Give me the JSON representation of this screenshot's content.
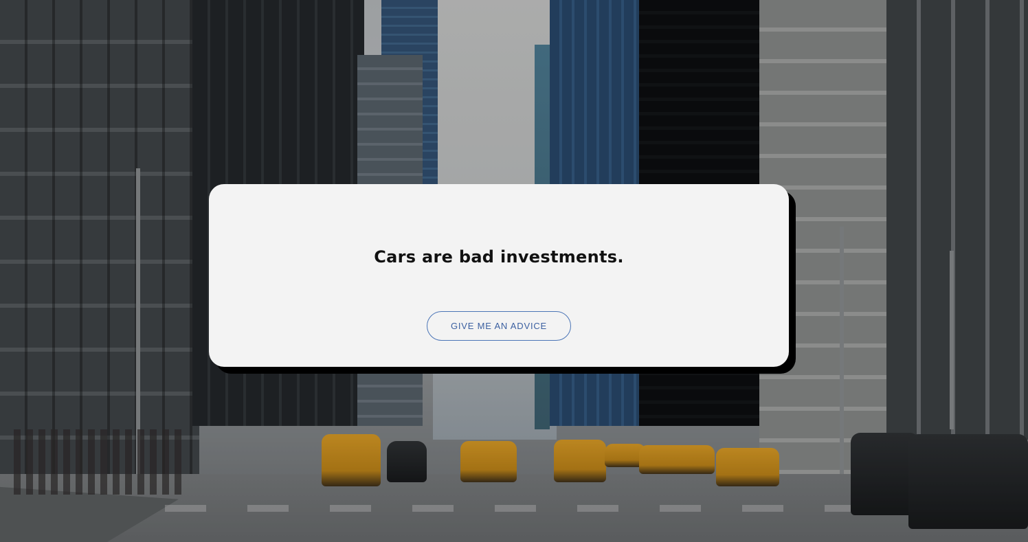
{
  "card": {
    "title": "Cars are bad investments.",
    "button_label": "GIVE ME AN ADVICE"
  },
  "colors": {
    "card_background": "#f3f3f3",
    "card_shadow": "#000000",
    "button_border": "#4a74b6",
    "button_text": "#3a5fa0",
    "title_text": "#111111"
  }
}
